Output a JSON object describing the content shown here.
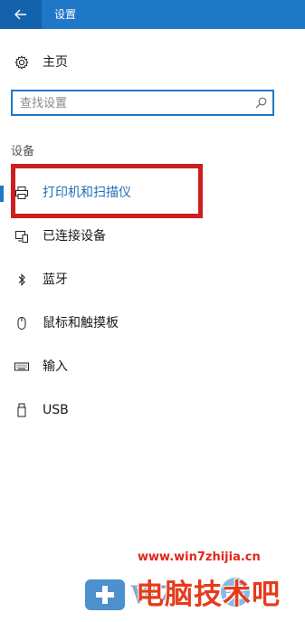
{
  "window": {
    "title": "设置"
  },
  "home": {
    "label": "主页",
    "icon": "gear-icon"
  },
  "search": {
    "placeholder": "查找设置",
    "icon": "search-icon"
  },
  "section": {
    "title": "设备"
  },
  "nav": {
    "items": [
      {
        "label": "打印机和扫描仪",
        "icon": "printer-icon",
        "active": true
      },
      {
        "label": "已连接设备",
        "icon": "connected-devices-icon"
      },
      {
        "label": "蓝牙",
        "icon": "bluetooth-icon"
      },
      {
        "label": "鼠标和触摸板",
        "icon": "mouse-icon"
      },
      {
        "label": "输入",
        "icon": "keyboard-icon"
      },
      {
        "label": "USB",
        "icon": "usb-icon"
      }
    ]
  },
  "watermark": {
    "url": "www.win7zhijia.cn",
    "brand_text": "电脑技术吧"
  },
  "colors": {
    "accent": "#1f78c6",
    "highlight_box": "#cc1f1f",
    "watermark": "#e53b1c"
  }
}
